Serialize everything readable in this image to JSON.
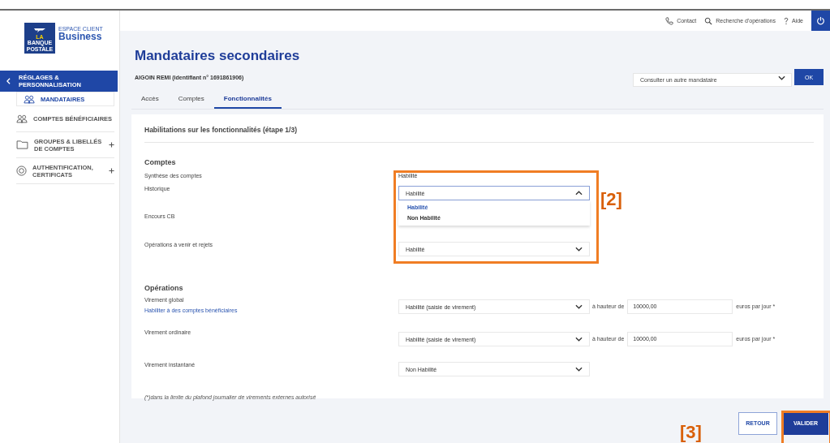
{
  "brand": {
    "logo_lines": [
      "LA",
      "BANQUE",
      "POSTALE"
    ],
    "line1": "ESPACE CLIENT",
    "line2": "Business"
  },
  "sidebar": {
    "back": "RÉGLAGES & PERSONNALISATION",
    "items": [
      {
        "label": "MANDATAIRES",
        "kind": "people",
        "selected": true,
        "expandable": false
      },
      {
        "label": "COMPTES BÉNÉFICIAIRES",
        "kind": "people",
        "selected": false,
        "expandable": false
      },
      {
        "label": "GROUPES & LIBELLÉS DE COMPTES",
        "kind": "folder",
        "selected": false,
        "expandable": true
      },
      {
        "label": "AUTHENTIFICATION, CERTIFICATS",
        "kind": "badge",
        "selected": false,
        "expandable": true
      }
    ]
  },
  "topbar": {
    "links": [
      {
        "label": "Contact",
        "kind": "phone"
      },
      {
        "label": "Recherche d'opérations",
        "kind": "search"
      },
      {
        "label": "Aide",
        "kind": "help"
      }
    ]
  },
  "page": {
    "title": "Mandataires secondaires",
    "subtitle": "AIGOIN REMI (identifiant n° 1691861906)",
    "selector": {
      "placeholder": "Consulter un autre mandataire"
    },
    "ok": "OK"
  },
  "tabs": [
    {
      "label": "Accès",
      "selected": false
    },
    {
      "label": "Comptes",
      "selected": false
    },
    {
      "label": "Fonctionnalités",
      "selected": true
    }
  ],
  "card": {
    "title": "Habilitations sur les fonctionnalités (étape 1/3)",
    "sections": [
      {
        "heading": "Comptes",
        "rows": [
          {
            "kind": "text",
            "label": "Synthèse des comptes",
            "value": "Habilité"
          },
          {
            "kind": "select",
            "label": "Historique",
            "value": "Habilité",
            "expanded": true,
            "options": [
              {
                "label": "Habilité",
                "selected": true
              },
              {
                "label": "Non Habilité",
                "selected": false
              }
            ]
          },
          {
            "kind": "hidden",
            "label": "Encours CB"
          },
          {
            "kind": "select",
            "label": "Opérations à venir et rejets",
            "value": "Habilité",
            "expanded": false
          }
        ]
      },
      {
        "heading": "Opérations",
        "rows": [
          {
            "kind": "select",
            "label": "Virement global",
            "link": "Habiliter à des comptes bénéficiaires",
            "value": "Habilité (saisie de virement)",
            "expanded": false,
            "limit": {
              "prefix": "à hauteur de",
              "value": "10000,00",
              "suffix": "euros par jour *"
            }
          },
          {
            "kind": "select",
            "label": "Virement ordinaire",
            "value": "Habilité (saisie de virement)",
            "expanded": false,
            "limit": {
              "prefix": "à hauteur de",
              "value": "10000,00",
              "suffix": "euros par jour *"
            }
          },
          {
            "kind": "select",
            "label": "Virement instantané",
            "value": "Non Habilité",
            "expanded": false
          }
        ]
      }
    ],
    "footnote": "(*)dans la limite du plafond journalier de virements externes autorisé"
  },
  "buttons": [
    {
      "label": "RETOUR",
      "kind": "secondary"
    },
    {
      "label": "VALIDER",
      "kind": "primary"
    }
  ],
  "annotations": [
    {
      "label": "[2]"
    },
    {
      "label": "[3]"
    }
  ]
}
